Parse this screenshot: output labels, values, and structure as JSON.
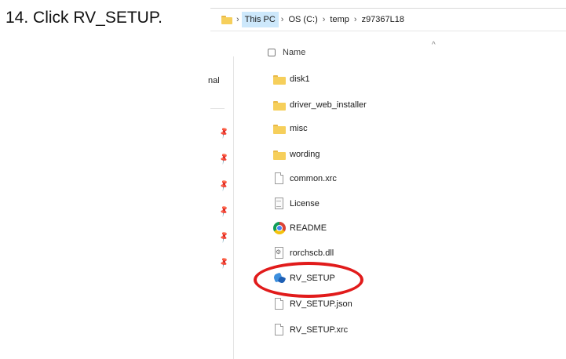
{
  "instruction": "14. Click RV_SETUP.",
  "breadcrumb": [
    "This PC",
    "OS (C:)",
    "temp",
    "z97367L18"
  ],
  "separator": "›",
  "nav_pane": {
    "partial_label": "nal"
  },
  "column_header": {
    "name": "Name",
    "sort_caret": "^"
  },
  "files": [
    {
      "name": "disk1",
      "icon": "folder-icon"
    },
    {
      "name": "driver_web_installer",
      "icon": "folder-icon"
    },
    {
      "name": "misc",
      "icon": "folder-icon"
    },
    {
      "name": "wording",
      "icon": "folder-icon"
    },
    {
      "name": "common.xrc",
      "icon": "document-icon"
    },
    {
      "name": "License",
      "icon": "text-document-icon"
    },
    {
      "name": "README",
      "icon": "chrome-icon"
    },
    {
      "name": "rorchscb.dll",
      "icon": "dll-icon"
    },
    {
      "name": "RV_SETUP",
      "icon": "setup-icon"
    },
    {
      "name": "RV_SETUP.json",
      "icon": "document-icon"
    },
    {
      "name": "RV_SETUP.xrc",
      "icon": "document-icon"
    }
  ],
  "colors": {
    "highlight": "#e11b1b",
    "selection": "#cde8fb",
    "folder": "#f6cf5b"
  }
}
